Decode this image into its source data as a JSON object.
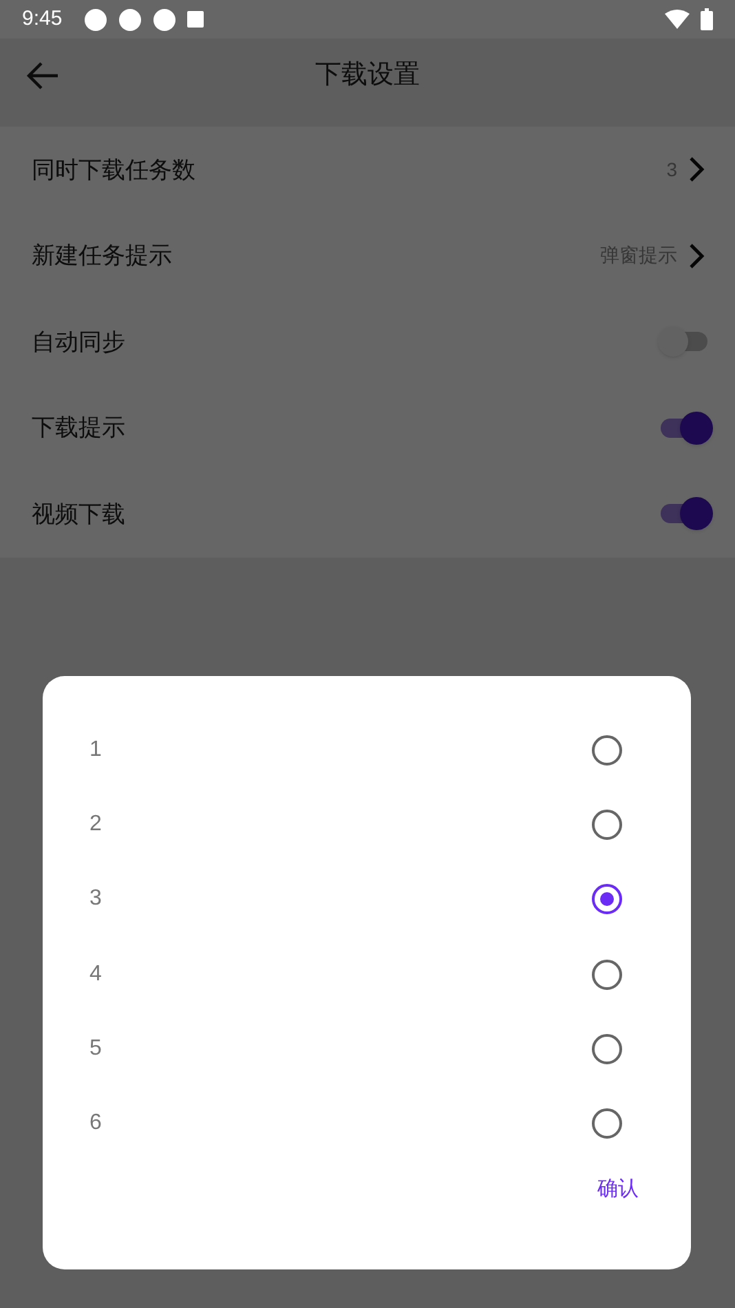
{
  "status_bar": {
    "time": "9:45"
  },
  "app_bar": {
    "title": "下载设置"
  },
  "settings": [
    {
      "kind": "link",
      "label": "同时下载任务数",
      "value": "3"
    },
    {
      "kind": "link",
      "label": "新建任务提示",
      "value": "弹窗提示"
    },
    {
      "kind": "toggle",
      "label": "自动同步",
      "on": false
    },
    {
      "kind": "toggle",
      "label": "下载提示",
      "on": true
    },
    {
      "kind": "toggle",
      "label": "视频下载",
      "on": true
    }
  ],
  "dialog": {
    "options": [
      {
        "label": "1",
        "selected": false
      },
      {
        "label": "2",
        "selected": false
      },
      {
        "label": "3",
        "selected": true
      },
      {
        "label": "4",
        "selected": false
      },
      {
        "label": "5",
        "selected": false
      },
      {
        "label": "6",
        "selected": false
      }
    ],
    "confirm_button": "确认"
  }
}
